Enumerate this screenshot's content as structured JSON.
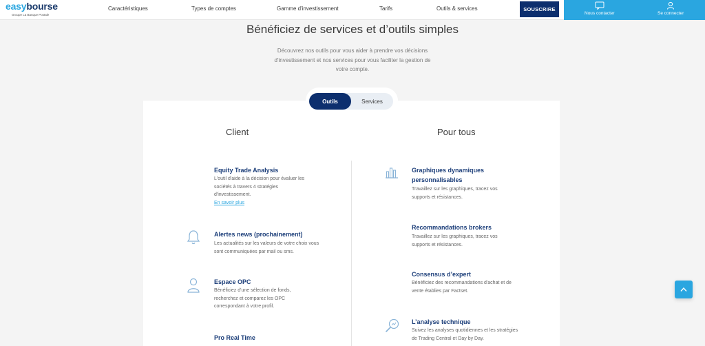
{
  "brand": {
    "logo_part1": "easy",
    "logo_part2": "bourse",
    "tagline": "Groupe La Banque Postale"
  },
  "nav": {
    "items": [
      "Caractéristiques",
      "Types de comptes",
      "Gamme d'investissement",
      "Tarifs",
      "Outils & services"
    ],
    "subscribe_label": "SOUSCRIRE",
    "contact_label": "Nous contacter",
    "login_label": "Se connecter"
  },
  "hero": {
    "title": "Bénéficiez de services et d’outils simples",
    "subtitle": "Découvrez nos outils pour vous aider à prendre vos décisions d'investissement et nos services pour vous faciliter la gestion de votre compte."
  },
  "tabs": {
    "active": "Outils",
    "inactive": "Services"
  },
  "columns": {
    "left_heading": "Client",
    "right_heading": "Pour tous"
  },
  "client_features": [
    {
      "title": "Equity Trade Analysis",
      "desc": "L'outil d'aide à la décision pour évaluer les sociétés à travers 4 stratégies d'investissement.",
      "link": "En savoir plus"
    },
    {
      "title": "Alertes news (prochainement)",
      "desc": "Les actualités sur les valeurs de votre choix vous sont communiquées par mail ou sms."
    },
    {
      "title": "Espace OPC",
      "desc": "Bénéficiez d'une sélection de fonds, recherchez et comparez les OPC correspondant à votre profil."
    },
    {
      "title": "Pro Real Time",
      "desc": ""
    }
  ],
  "public_features": [
    {
      "title": "Graphiques dynamiques personnalisables",
      "desc": "Travaillez sur les graphiques, tracez vos supports et résistances."
    },
    {
      "title": "Recommandations brokers",
      "desc": "Travaillez sur les graphiques, tracez vos supports et résistances."
    },
    {
      "title": "Consensus d’expert",
      "desc": "Bénéficiez des recommandations d'achat et de vente établies par Factset."
    },
    {
      "title": "L’analyse technique",
      "desc": "Suivez les analyses quotidiennes et les stratégies de Trading Central et Day by Day."
    }
  ],
  "colors": {
    "navy": "#0d2f6e",
    "accent": "#2aa6e0",
    "title_blue": "#1d3f7a"
  }
}
